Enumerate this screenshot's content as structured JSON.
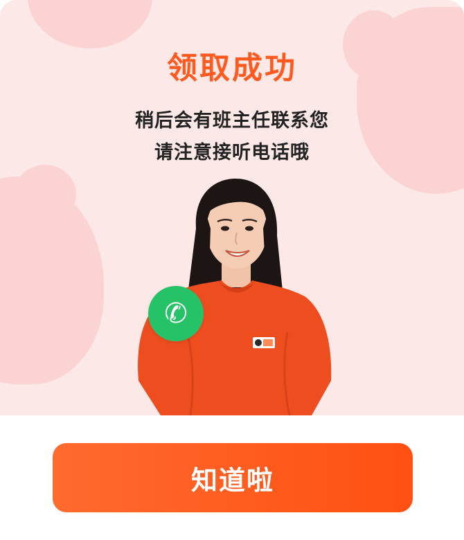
{
  "dialog": {
    "title": "领取成功",
    "subtitle_line1": "稍后会有班主任联系您",
    "subtitle_line2": "请注意接听电话哦",
    "badge_icon": "phone-icon",
    "badge_glyph": "✆",
    "ok_label": "知道啦",
    "colors": {
      "accent": "#ff5a1f",
      "background": "#fde8e8",
      "badge": "#25c267"
    }
  }
}
